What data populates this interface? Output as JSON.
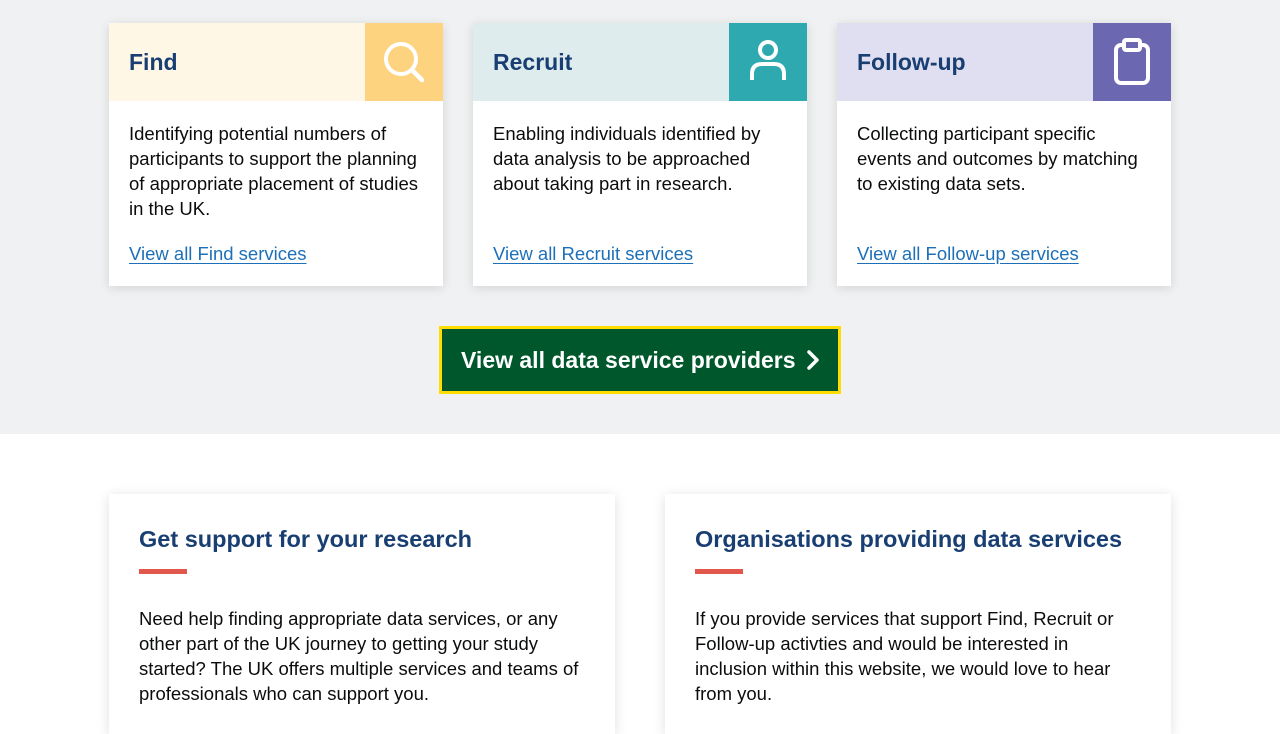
{
  "colors": {
    "band": "#f0f1f2",
    "heading_blue": "#193e72",
    "link_blue": "#1d70b8",
    "find_accent": "#fed37f",
    "recruit_accent": "#2ea9b0",
    "followup_accent": "#6b67b0",
    "cta_green": "#00572c",
    "cta_focus": "#ffdd00",
    "rule_red": "#e2574c"
  },
  "cards": [
    {
      "title": "Find",
      "icon": "search-icon",
      "description": "Identifying potential numbers of participants to support the planning of appropriate placement of studies in the UK.",
      "link": "View all Find services"
    },
    {
      "title": "Recruit",
      "icon": "person-icon",
      "description": "Enabling individuals identified by data analysis to be approached about taking part in research.",
      "link": "View all Recruit services"
    },
    {
      "title": "Follow-up",
      "icon": "clipboard-icon",
      "description": "Collecting participant specific events and outcomes by matching to existing data sets.",
      "link": "View all Follow-up services"
    }
  ],
  "cta": {
    "label": "View all data service providers",
    "icon": "chevron-right-icon"
  },
  "panels": [
    {
      "title": "Get support for your research",
      "text": "Need help finding appropriate data services, or any other part of the UK journey to getting your study started? The UK offers multiple services and teams of professionals who can support you."
    },
    {
      "title": "Organisations providing data services",
      "text": "If you provide services that support Find, Recruit or Follow-up activties and would be interested in inclusion within this website, we would love to hear from you."
    }
  ]
}
